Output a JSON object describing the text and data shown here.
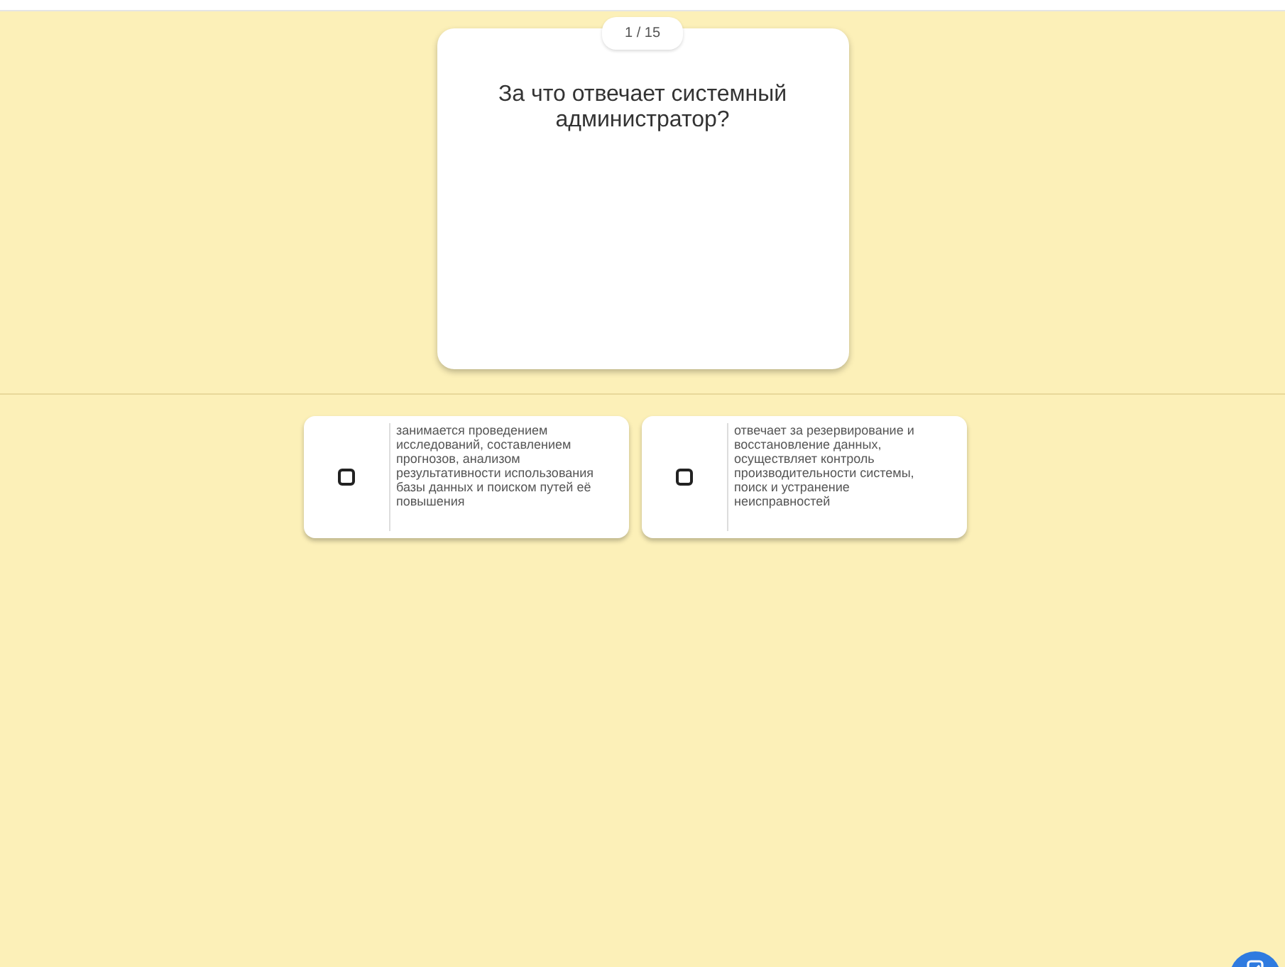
{
  "counter": "1 / 15",
  "question": "За что отвечает системный администратор?",
  "options": [
    {
      "text": "занимается проведением исследований, составлением прогнозов, анализом результативности использования базы данных и поиском путей её повышения",
      "checked": false
    },
    {
      "text": "отвечает за резервирование и восстановление данных, осуществляет контроль производительности системы, поиск и устранение неисправностей",
      "checked": false
    }
  ]
}
